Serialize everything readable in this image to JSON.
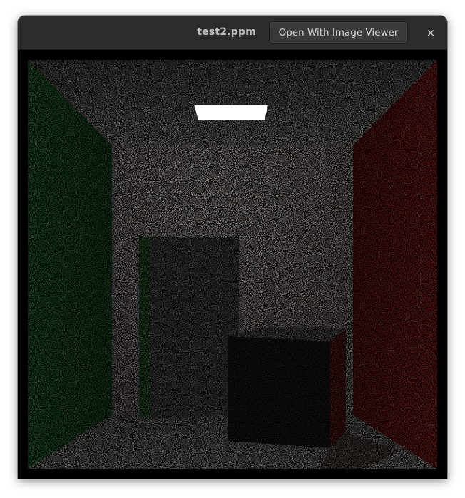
{
  "window": {
    "title": "test2.ppm",
    "open_button_label": "Open With Image Viewer",
    "close_glyph": "×"
  },
  "image": {
    "description_icon": "rendered-image",
    "colors": {
      "left_wall": "#2f6b3a",
      "right_wall": "#8a2222",
      "back_wall": "#8c8580",
      "ceiling": "#6f6b68",
      "floor": "#7b7672",
      "light": "#ffffff",
      "tall_box_front": "#504a47",
      "tall_box_side": "#2c5e2f",
      "short_box_front": "#1e1c1b",
      "short_box_top": "#565150",
      "short_box_side": "#5a1a1a"
    }
  }
}
